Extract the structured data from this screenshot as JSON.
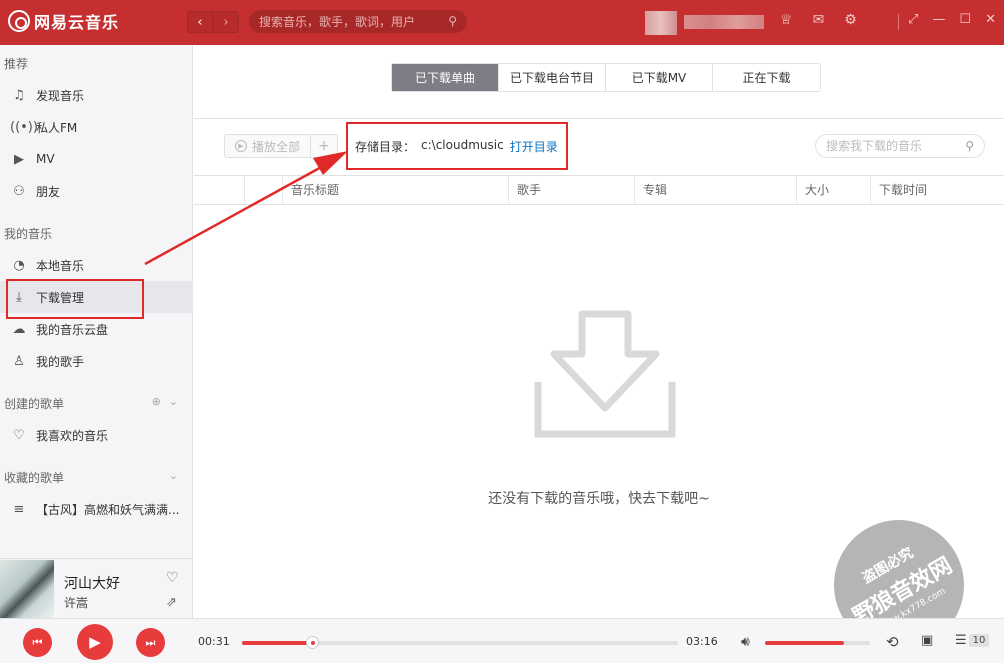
{
  "app": {
    "logo": "网易云音乐",
    "search_placeholder": "搜索音乐，歌手，歌词，用户"
  },
  "sidebar": {
    "sections": {
      "recommend": "推荐",
      "my_music": "我的音乐",
      "created": "创建的歌单",
      "collected": "收藏的歌单"
    },
    "recommend_items": [
      "发现音乐",
      "私人FM",
      "MV",
      "朋友"
    ],
    "my_music_items": [
      "本地音乐",
      "下载管理",
      "我的音乐云盘",
      "我的歌手"
    ],
    "created_items": [
      "我喜欢的音乐"
    ],
    "collected_items": [
      "【古风】高燃和妖气满满..."
    ]
  },
  "now_playing": {
    "title": "河山大好",
    "artist": "许嵩"
  },
  "tabs": [
    "已下载单曲",
    "已下载电台节目",
    "已下载MV",
    "正在下载"
  ],
  "toolbar": {
    "play_all": "播放全部",
    "add": "+",
    "storage_label": "存储目录：",
    "storage_path": "c:\\cloudmusic",
    "open_dir": "打开目录",
    "search_placeholder": "搜索我下载的音乐"
  },
  "table": {
    "headers": [
      "音乐标题",
      "歌手",
      "专辑",
      "大小",
      "下载时间"
    ]
  },
  "empty_text": "还没有下载的音乐哦，快去下载吧~",
  "player": {
    "current_time": "00:31",
    "total_time": "03:16",
    "progress": 0.16,
    "volume": 0.75,
    "playlist_count": "10"
  },
  "watermark": {
    "line1": "盗图必究",
    "line2": "野狼音效网",
    "line3": "www.kx778.com"
  },
  "colors": {
    "brand_red": "#c62f2f",
    "accent_red": "#e83c3c",
    "annotation_red": "#e02a2a",
    "link_blue": "#0c73c2"
  }
}
